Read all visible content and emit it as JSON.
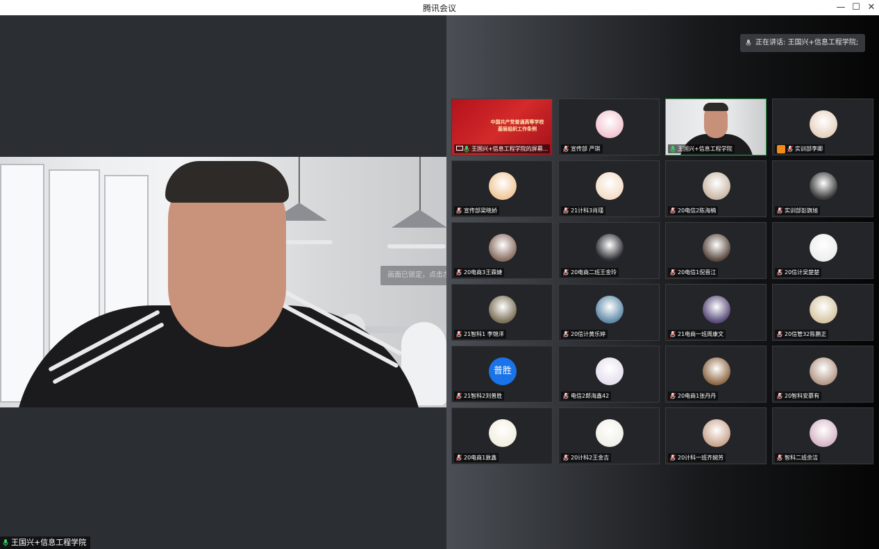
{
  "window": {
    "title": "腾讯会议",
    "controls": {
      "minimize": "—",
      "maximize": "☐",
      "close": "✕"
    }
  },
  "main_video": {
    "name": "王国兴+信息工程学院",
    "lock_tip": "画面已锁定，点击左上角"
  },
  "speaking_indicator": {
    "text": "正在讲话: 王国兴+信息工程学院;"
  },
  "participants": [
    {
      "name": "王国兴+信息工程学院的屏幕...",
      "kind": "screen-share",
      "share_line1": "中国共产党普通高等学校",
      "share_line2": "基层组织工作条例",
      "mic": "active"
    },
    {
      "name": "宣传部 严琪",
      "kind": "avatar",
      "avatar_color": "#f3c6d2",
      "mic": "muted"
    },
    {
      "name": "王国兴+信息工程学院",
      "kind": "camera",
      "mic": "active",
      "active": true
    },
    {
      "name": "实训部李卿",
      "kind": "avatar",
      "avatar_color": "#e9d3c0",
      "mic": "muted",
      "badge": "orange"
    },
    {
      "name": "宣传部梁晓娇",
      "kind": "avatar",
      "avatar_color": "#f1c89a",
      "mic": "muted"
    },
    {
      "name": "21计科3肖瑾",
      "kind": "avatar",
      "avatar_color": "#f4ddc8",
      "mic": "muted"
    },
    {
      "name": "20电信2陈海楠",
      "kind": "avatar",
      "avatar_color": "#cbb9a8",
      "mic": "muted"
    },
    {
      "name": "实训部彭旗旭",
      "kind": "avatar",
      "avatar_color": "#3b3b3b",
      "mic": "muted"
    },
    {
      "name": "20电商3王霖婕",
      "kind": "avatar",
      "avatar_color": "#8a6e62",
      "mic": "muted"
    },
    {
      "name": "20电商二班王金玲",
      "kind": "avatar",
      "avatar_color": "#2c2c34",
      "mic": "muted"
    },
    {
      "name": "20电信1倪晋江",
      "kind": "avatar",
      "avatar_color": "#5b4a40",
      "mic": "muted"
    },
    {
      "name": "20信计吴楚楚",
      "kind": "avatar",
      "avatar_color": "#eeeeee",
      "mic": "muted"
    },
    {
      "name": "21智科1 李锦洋",
      "kind": "avatar",
      "avatar_color": "#7d7259",
      "mic": "muted"
    },
    {
      "name": "20信计黄乐婷",
      "kind": "avatar",
      "avatar_color": "#5f8aa8",
      "mic": "muted"
    },
    {
      "name": "21电商一班周康文",
      "kind": "avatar",
      "avatar_color": "#5a4b7a",
      "mic": "muted"
    },
    {
      "name": "20信管32陈鹏正",
      "kind": "avatar",
      "avatar_color": "#d7c7a5",
      "mic": "muted"
    },
    {
      "name": "21智科2刘普胜",
      "kind": "text-avatar",
      "avatar_text": "普胜",
      "avatar_color": "#1a73e8",
      "mic": "muted"
    },
    {
      "name": "电信2郎海鑫42",
      "kind": "avatar",
      "avatar_color": "#e6e0ef",
      "mic": "muted"
    },
    {
      "name": "20电商1张丹丹",
      "kind": "avatar",
      "avatar_color": "#8f6a48",
      "mic": "muted"
    },
    {
      "name": "20智科安慕有",
      "kind": "avatar",
      "avatar_color": "#b59a8a",
      "mic": "muted"
    },
    {
      "name": "20电商1敦鑫",
      "kind": "avatar",
      "avatar_color": "#f2efdf",
      "mic": "muted"
    },
    {
      "name": "20计科2王金吉",
      "kind": "avatar",
      "avatar_color": "#f0efe8",
      "mic": "muted"
    },
    {
      "name": "20计科一班齐婉芳",
      "kind": "avatar",
      "avatar_color": "#caa68e",
      "mic": "muted"
    },
    {
      "name": "智科二班余洁",
      "kind": "avatar",
      "avatar_color": "#d7b8c6",
      "mic": "muted"
    }
  ]
}
